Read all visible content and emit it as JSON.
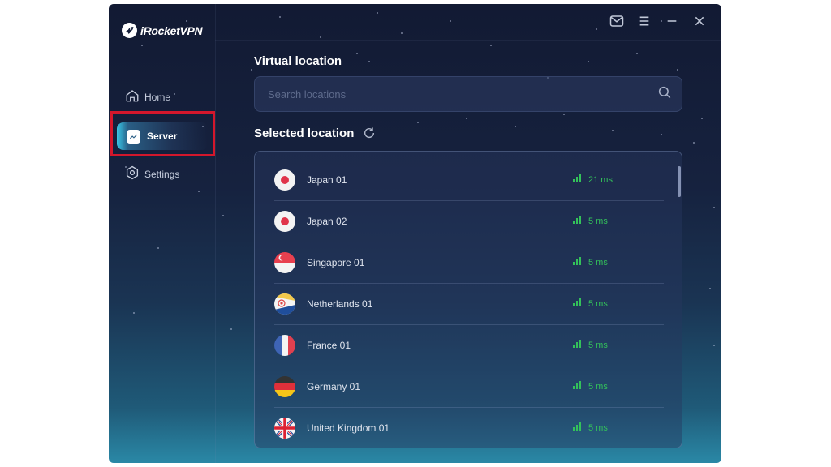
{
  "app": {
    "name": "iRocketVPN"
  },
  "titlebar": {
    "icons": [
      "mail-icon",
      "menu-icon",
      "minimize-icon",
      "close-icon"
    ]
  },
  "sidebar": {
    "items": [
      {
        "label": "Home",
        "icon": "home-icon",
        "active": false
      },
      {
        "label": "Server",
        "icon": "chart-icon",
        "active": true
      },
      {
        "label": "Settings",
        "icon": "gear-icon",
        "active": false
      }
    ]
  },
  "main": {
    "virtual_location_title": "Virtual location",
    "search_placeholder": "Search locations",
    "search_value": "",
    "selected_location_title": "Selected location",
    "locations": [
      {
        "name": "Japan 01",
        "flag": "jp",
        "ping": "21 ms"
      },
      {
        "name": "Japan 02",
        "flag": "jp",
        "ping": "5 ms"
      },
      {
        "name": "Singapore 01",
        "flag": "sg",
        "ping": "5 ms"
      },
      {
        "name": "Netherlands 01",
        "flag": "nl",
        "ping": "5 ms"
      },
      {
        "name": "France 01",
        "flag": "fr",
        "ping": "5 ms"
      },
      {
        "name": "Germany 01",
        "flag": "de",
        "ping": "5 ms"
      },
      {
        "name": "United Kingdom 01",
        "flag": "gb",
        "ping": "5 ms"
      }
    ]
  },
  "colors": {
    "ping_good": "#33c25a",
    "highlight_box": "#d3172c",
    "accent": "#38c8e8"
  }
}
